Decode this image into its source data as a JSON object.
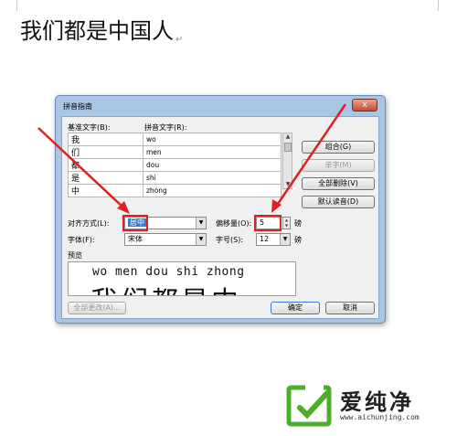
{
  "document": {
    "text": "我们都是中国人"
  },
  "dialog": {
    "title": "拼音指南",
    "close_label": "x",
    "base_label": "基准文字(B):",
    "ruby_label": "拼音文字(R):",
    "rows": [
      {
        "base": "我",
        "ruby": "wo"
      },
      {
        "base": "们",
        "ruby": "men"
      },
      {
        "base": "都",
        "ruby": "dou"
      },
      {
        "base": "是",
        "ruby": "shi"
      },
      {
        "base": "中",
        "ruby": "zhong"
      }
    ],
    "buttons": {
      "group": "组合(G)",
      "mono": "单字(M)",
      "clear_all": "全部删除(V)",
      "default_reading": "默认读音(D)",
      "modify_all": "全部更改(A)...",
      "ok": "确定",
      "cancel": "取消"
    },
    "alignment_label": "对齐方式(L):",
    "alignment_value": "居中",
    "offset_label": "偏移量(O):",
    "offset_value": "5",
    "offset_unit": "磅",
    "font_label": "字体(F):",
    "font_value": "宋体",
    "size_label": "字号(S):",
    "size_value": "12",
    "size_unit": "磅",
    "preview_label": "预览",
    "preview_pinyin": "wo men dou shi zhong",
    "preview_hanzi": "我们都是中"
  },
  "watermark": {
    "brand": "爱纯净",
    "url": "www.aichunjing.com"
  },
  "colors": {
    "annotation_red": "#e02020",
    "watermark_green": "#4caf2a"
  }
}
